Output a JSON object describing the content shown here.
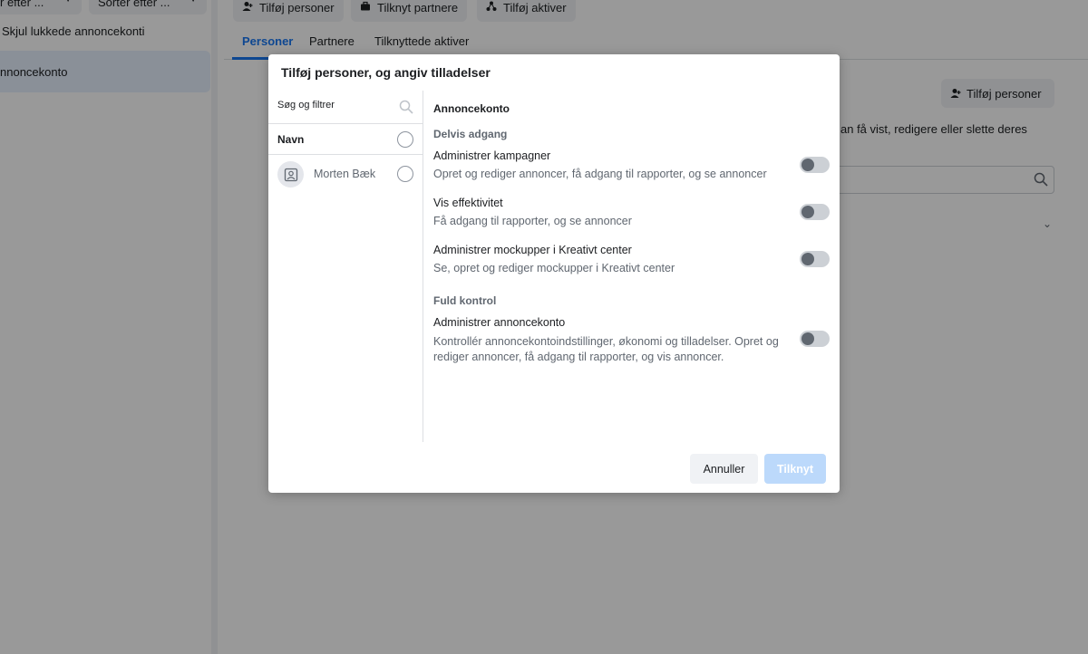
{
  "background": {
    "left_panel": {
      "filter_button_label": "r efter ...",
      "sort_button_label": "Sorter efter ...",
      "hide_closed_label": "Skjul lukkede annoncekonti",
      "selected_account_label": "nnoncekonto"
    },
    "toolbar": {
      "add_people_label": "Tilføj personer",
      "connect_partners_label": "Tilknyt partnere",
      "add_assets_label": "Tilføj aktiver"
    },
    "tabs": [
      {
        "label": "Personer"
      },
      {
        "label": "Partnere"
      },
      {
        "label": "Tilknyttede aktiver"
      }
    ],
    "right_add_people_label": "Tilføj personer",
    "right_description": "an få vist, redigere eller slette deres"
  },
  "modal": {
    "title": "Tilføj personer, og angiv tilladelser",
    "search": {
      "placeholder": "Søg og filtrer"
    },
    "name_header": "Navn",
    "people": [
      {
        "name": "Morten Bæk"
      }
    ],
    "section_title": "Annoncekonto",
    "groups": [
      {
        "label": "Delvis adgang",
        "permissions": [
          {
            "title": "Administrer kampagner",
            "description": "Opret og rediger annoncer, få adgang til rapporter, og se annoncer",
            "enabled": false
          },
          {
            "title": "Vis effektivitet",
            "description": "Få adgang til rapporter, og se annoncer",
            "enabled": false
          },
          {
            "title": "Administrer mockupper i Kreativt center",
            "description": "Se, opret og rediger mockupper i Kreativt center",
            "enabled": false
          }
        ]
      },
      {
        "label": "Fuld kontrol",
        "permissions": [
          {
            "title": "Administrer annoncekonto",
            "description": "Kontrollér annoncekontoindstillinger, økonomi og tilladelser. Opret og rediger annoncer, få adgang til rapporter, og vis annoncer.",
            "enabled": false
          }
        ]
      }
    ],
    "cancel_label": "Annuller",
    "confirm_label": "Tilknyt"
  },
  "colors": {
    "accent": "#1877f2",
    "overlay": "rgba(0,0,0,0.4)",
    "disabled_button": "#bcd9fb"
  },
  "icons": [
    "chevron-down-icon",
    "add-person-icon",
    "briefcase-icon",
    "assets-icon",
    "search-icon",
    "avatar-placeholder-icon"
  ]
}
